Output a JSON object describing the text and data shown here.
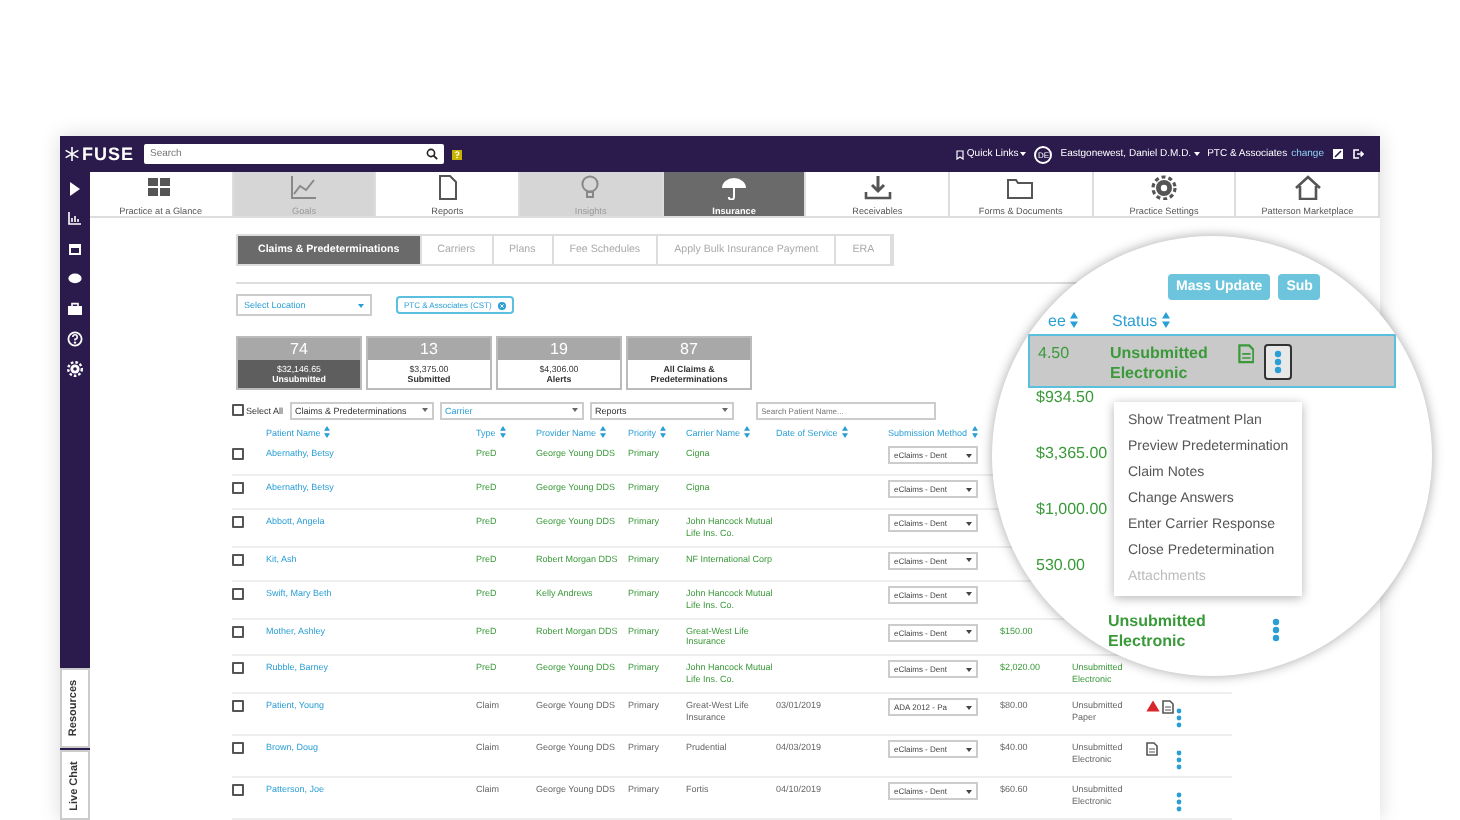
{
  "topbar": {
    "logo": "FUSE",
    "search": {
      "placeholder": "Search"
    },
    "quick_links": "Quick Links",
    "avatar": "DE",
    "user": "Eastgonewest, Daniel D.M.D.",
    "practice": "PTC & Associates",
    "change_link": "change"
  },
  "nav": [
    {
      "label": "Practice at a Glance",
      "selected": false,
      "disabled": false
    },
    {
      "label": "Goals",
      "selected": false,
      "disabled": true
    },
    {
      "label": "Reports",
      "selected": false,
      "disabled": false
    },
    {
      "label": "Insights",
      "selected": false,
      "disabled": true
    },
    {
      "label": "Insurance",
      "selected": true,
      "disabled": false
    },
    {
      "label": "Receivables",
      "selected": false,
      "disabled": false
    },
    {
      "label": "Forms & Documents",
      "selected": false,
      "disabled": false
    },
    {
      "label": "Practice Settings",
      "selected": false,
      "disabled": false
    },
    {
      "label": "Patterson Marketplace",
      "selected": false,
      "disabled": false
    }
  ],
  "tabs": [
    {
      "label": "Claims & Predeterminations",
      "selected": true
    },
    {
      "label": "Carriers",
      "selected": false
    },
    {
      "label": "Plans",
      "selected": false
    },
    {
      "label": "Fee Schedules",
      "selected": false
    },
    {
      "label": "Apply Bulk Insurance Payment",
      "selected": false
    },
    {
      "label": "ERA",
      "selected": false
    }
  ],
  "location_select": "Select Location",
  "location_chip": "PTC & Associates (CST)",
  "stats": [
    {
      "count": "74",
      "amount": "$32,146.65",
      "label": "Unsubmitted",
      "selected": true
    },
    {
      "count": "13",
      "amount": "$3,375.00",
      "label": "Submitted",
      "selected": false
    },
    {
      "count": "19",
      "amount": "$4,306.00",
      "label": "Alerts",
      "selected": false
    },
    {
      "count": "87",
      "label": "All Claims & Predeterminations",
      "selected": false
    }
  ],
  "filters": {
    "select_all": "Select All",
    "checked": false,
    "type": "Claims & Predeterminations",
    "carrier": "Carrier",
    "reports": "Reports",
    "search_placeholder": "Search Patient Name..."
  },
  "table": {
    "columns": [
      "Patient Name",
      "Type",
      "Provider Name",
      "Priority",
      "Carrier Name",
      "Date of Service",
      "Submission Method"
    ],
    "rows": [
      {
        "kind": "predetermination",
        "patient": "Abernathy, Betsy",
        "type": "PreD",
        "provider": "George Young DDS",
        "priority": "Primary",
        "carrier": "Cigna",
        "method": "eClaims - Dent",
        "checked": false
      },
      {
        "kind": "predetermination",
        "patient": "Abernathy, Betsy",
        "type": "PreD",
        "provider": "George Young DDS",
        "priority": "Primary",
        "carrier": "Cigna",
        "method": "eClaims - Dent",
        "checked": false
      },
      {
        "kind": "predetermination",
        "patient": "Abbott, Angela",
        "type": "PreD",
        "provider": "George Young DDS",
        "priority": "Primary",
        "carrier": "John Hancock Mutual Life Ins. Co.",
        "method": "eClaims - Dent",
        "checked": false
      },
      {
        "kind": "predetermination",
        "patient": "Kit, Ash",
        "type": "PreD",
        "provider": "Robert Morgan DDS",
        "priority": "Primary",
        "carrier": "NF International Corp",
        "method": "eClaims - Dent",
        "checked": false
      },
      {
        "kind": "predetermination",
        "patient": "Swift, Mary Beth",
        "type": "PreD",
        "provider": "Kelly Andrews",
        "priority": "Primary",
        "carrier": "John Hancock Mutual Life Ins. Co.",
        "method": "eClaims - Dent",
        "checked": false
      },
      {
        "kind": "predetermination",
        "patient": "Mother, Ashley",
        "type": "PreD",
        "provider": "Robert Morgan DDS",
        "priority": "Primary",
        "carrier": "Great-West Life Insurance",
        "method": "eClaims - Dent",
        "fee": "$150.00",
        "checked": false
      },
      {
        "kind": "predetermination",
        "patient": "Rubble, Barney",
        "type": "PreD",
        "provider": "George Young DDS",
        "priority": "Primary",
        "carrier": "John Hancock Mutual Life Ins. Co.",
        "method": "eClaims - Dent",
        "fee": "$2,020.00",
        "status": "Unsubmitted Electronic",
        "checked": false
      },
      {
        "kind": "claim",
        "patient": "Patient, Young",
        "type": "Claim",
        "provider": "George Young DDS",
        "priority": "Primary",
        "carrier": "Great-West Life Insurance",
        "date": "03/01/2019",
        "method": "ADA 2012 - Pa",
        "fee": "$80.00",
        "status": "Unsubmitted Paper",
        "alert": true,
        "document": true,
        "menu": true,
        "checked": false
      },
      {
        "kind": "claim",
        "patient": "Brown, Doug",
        "type": "Claim",
        "provider": "George Young DDS",
        "priority": "Primary",
        "carrier": "Prudential",
        "date": "04/03/2019",
        "method": "eClaims - Dent",
        "fee": "$40.00",
        "status": "Unsubmitted Electronic",
        "alert": false,
        "document": true,
        "menu": true,
        "checked": false
      },
      {
        "kind": "claim",
        "patient": "Patterson, Joe",
        "type": "Claim",
        "provider": "George Young DDS",
        "priority": "Primary",
        "carrier": "Fortis",
        "date": "04/10/2019",
        "method": "eClaims - Dent",
        "fee": "$60.60",
        "status": "Unsubmitted Electronic",
        "alert": false,
        "document": false,
        "menu": true,
        "checked": false
      }
    ]
  },
  "magnifier": {
    "buttons": [
      "Mass Update",
      "Sub"
    ],
    "columns": [
      "ee",
      "Status"
    ],
    "rows": [
      {
        "fee": "4.50",
        "status": "Unsubmitted Electronic",
        "selected": true,
        "document": true,
        "menu": true
      },
      {
        "fee": "$934.50",
        "selected": false
      },
      {
        "fee": "$3,365.00",
        "selected": false
      },
      {
        "fee": "$1,000.00",
        "selected": false
      },
      {
        "fee": "530.00",
        "selected": false
      },
      {
        "status": "Unsubmitted Electronic",
        "selected": false,
        "menu": true
      }
    ],
    "context_menu": [
      {
        "label": "Show Treatment Plan",
        "disabled": false
      },
      {
        "label": "Preview Predetermination",
        "disabled": false
      },
      {
        "label": "Claim Notes",
        "disabled": false
      },
      {
        "label": "Change Answers",
        "disabled": false
      },
      {
        "label": "Enter Carrier Response",
        "disabled": false
      },
      {
        "label": "Close Predetermination",
        "disabled": false
      },
      {
        "label": "Attachments",
        "disabled": true
      }
    ]
  },
  "sidebar": {
    "resources": "Resources",
    "live_chat": "Live Chat"
  }
}
